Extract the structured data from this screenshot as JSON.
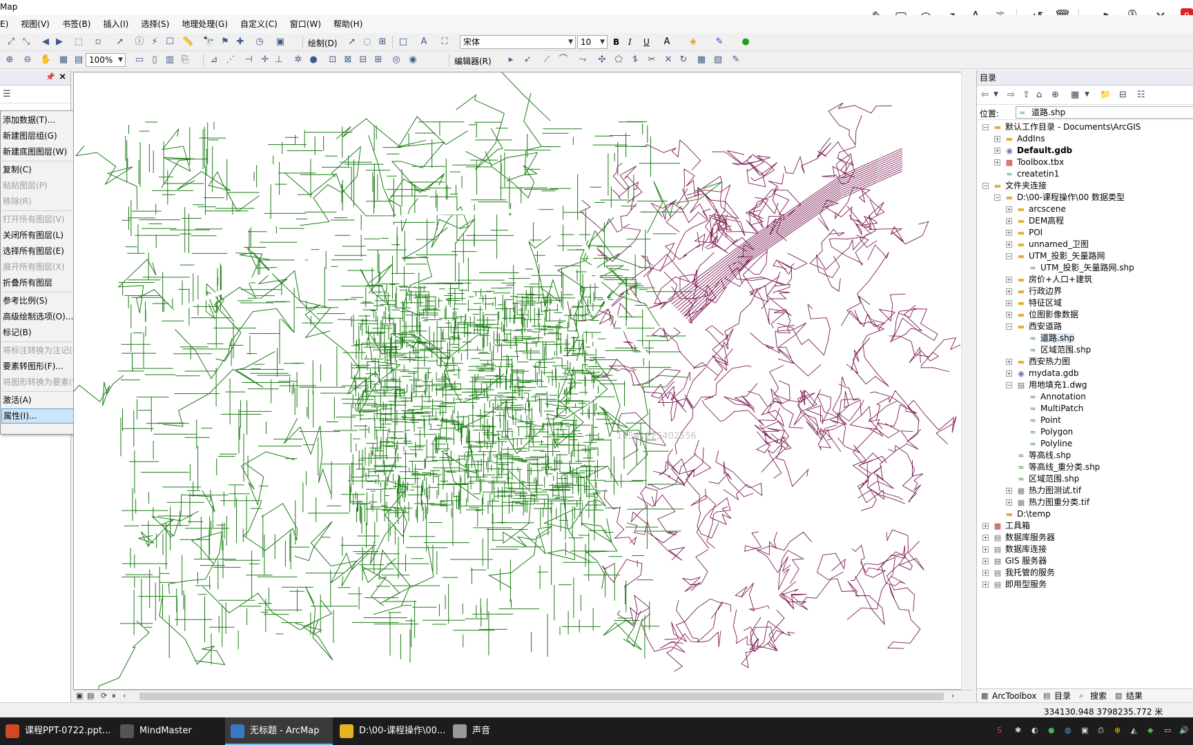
{
  "window": {
    "title": "Map"
  },
  "menu": [
    "E)",
    "视图(V)",
    "书签(B)",
    "插入(I)",
    "选择(S)",
    "地理处理(G)",
    "自定义(C)",
    "窗口(W)",
    "帮助(H)"
  ],
  "toolbar1": {
    "draw_label": "绘制(D)",
    "font_name": "宋体",
    "font_size": "10",
    "bold": "B",
    "italic": "I",
    "underline": "U"
  },
  "toolbar2": {
    "zoom": "100%",
    "editor_label": "编辑器(R)"
  },
  "toc_menu": {
    "items": [
      {
        "label": "添加数据(T)...",
        "enabled": true
      },
      {
        "label": "新建图层组(G)",
        "enabled": true
      },
      {
        "label": "新建底图图层(W)",
        "enabled": true
      },
      {
        "label": "复制(C)",
        "enabled": true
      },
      {
        "label": "粘贴图层(P)",
        "enabled": false
      },
      {
        "label": "移除(R)",
        "enabled": false
      },
      {
        "label": "打开所有图层(V)",
        "enabled": false
      },
      {
        "label": "关闭所有图层(L)",
        "enabled": true
      },
      {
        "label": "选择所有图层(E)",
        "enabled": true
      },
      {
        "label": "展开所有图层(X)",
        "enabled": false
      },
      {
        "label": "折叠所有图层",
        "enabled": true
      },
      {
        "label": "参考比例(S)",
        "enabled": true,
        "submenu": true
      },
      {
        "label": "高级绘制选项(O)...",
        "enabled": true
      },
      {
        "label": "标记(B)",
        "enabled": true,
        "submenu": true
      },
      {
        "label": "将标注转换为注记(N)...",
        "enabled": false
      },
      {
        "label": "要素转图形(F)...",
        "enabled": true
      },
      {
        "label": "将图形转换为要素(V)...",
        "enabled": false
      },
      {
        "label": "激活(A)",
        "enabled": true
      },
      {
        "label": "属性(I)...",
        "enabled": true,
        "selected": true
      }
    ]
  },
  "map": {
    "watermark": "11541225402556",
    "colors": {
      "road_green": "#1a7a12",
      "road_purple": "#7a1a52"
    }
  },
  "catalog": {
    "title": "目录",
    "location_label": "位置:",
    "location_value": "道路.shp",
    "tree": [
      {
        "label": "默认工作目录 - Documents\\ArcGIS",
        "level": 0,
        "exp": "-",
        "icon": "folder"
      },
      {
        "label": "AddIns",
        "level": 1,
        "exp": "+",
        "icon": "folder"
      },
      {
        "label": "Default.gdb",
        "level": 1,
        "exp": "+",
        "icon": "gdb",
        "bold": true
      },
      {
        "label": "Toolbox.tbx",
        "level": 1,
        "exp": "+",
        "icon": "tbx"
      },
      {
        "label": "createtin1",
        "level": 1,
        "exp": "",
        "icon": "shp"
      },
      {
        "label": "文件夹连接",
        "level": 0,
        "exp": "-",
        "icon": "folder"
      },
      {
        "label": "D:\\00-课程操作\\00 数据类型",
        "level": 1,
        "exp": "-",
        "icon": "folder"
      },
      {
        "label": "arcscene",
        "level": 2,
        "exp": "+",
        "icon": "folder"
      },
      {
        "label": "DEM高程",
        "level": 2,
        "exp": "+",
        "icon": "folder"
      },
      {
        "label": "POI",
        "level": 2,
        "exp": "+",
        "icon": "folder"
      },
      {
        "label": "unnamed_卫图",
        "level": 2,
        "exp": "+",
        "icon": "folder"
      },
      {
        "label": "UTM_投影_矢量路网",
        "level": 2,
        "exp": "-",
        "icon": "folder"
      },
      {
        "label": "UTM_投影_矢量路网.shp",
        "level": 3,
        "exp": "",
        "icon": "shp"
      },
      {
        "label": "房价+人口+建筑",
        "level": 2,
        "exp": "+",
        "icon": "folder"
      },
      {
        "label": "行政边界",
        "level": 2,
        "exp": "+",
        "icon": "folder"
      },
      {
        "label": "特征区域",
        "level": 2,
        "exp": "+",
        "icon": "folder"
      },
      {
        "label": "位图影像数据",
        "level": 2,
        "exp": "+",
        "icon": "folder"
      },
      {
        "label": "西安道路",
        "level": 2,
        "exp": "-",
        "icon": "folder"
      },
      {
        "label": "道路.shp",
        "level": 3,
        "exp": "",
        "icon": "shp",
        "highlight": true
      },
      {
        "label": "区域范围.shp",
        "level": 3,
        "exp": "",
        "icon": "shp"
      },
      {
        "label": "西安热力图",
        "level": 2,
        "exp": "+",
        "icon": "folder"
      },
      {
        "label": "mydata.gdb",
        "level": 2,
        "exp": "+",
        "icon": "gdb"
      },
      {
        "label": "用地填充1.dwg",
        "level": 2,
        "exp": "-",
        "icon": "srv"
      },
      {
        "label": "Annotation",
        "level": 3,
        "exp": "",
        "icon": "shp"
      },
      {
        "label": "MultiPatch",
        "level": 3,
        "exp": "",
        "icon": "shp"
      },
      {
        "label": "Point",
        "level": 3,
        "exp": "",
        "icon": "shp"
      },
      {
        "label": "Polygon",
        "level": 3,
        "exp": "",
        "icon": "shp"
      },
      {
        "label": "Polyline",
        "level": 3,
        "exp": "",
        "icon": "shp"
      },
      {
        "label": "等高线.shp",
        "level": 2,
        "exp": "",
        "icon": "shp"
      },
      {
        "label": "等高线_重分类.shp",
        "level": 2,
        "exp": "",
        "icon": "shp"
      },
      {
        "label": "区域范围.shp",
        "level": 2,
        "exp": "",
        "icon": "shp"
      },
      {
        "label": "热力图测试.tif",
        "level": 2,
        "exp": "+",
        "icon": "tif"
      },
      {
        "label": "热力图重分类.tif",
        "level": 2,
        "exp": "+",
        "icon": "tif"
      },
      {
        "label": "D:\\temp",
        "level": 1,
        "exp": "",
        "icon": "folder"
      },
      {
        "label": "工具箱",
        "level": 0,
        "exp": "+",
        "icon": "tbx"
      },
      {
        "label": "数据库服务器",
        "level": 0,
        "exp": "+",
        "icon": "srv"
      },
      {
        "label": "数据库连接",
        "level": 0,
        "exp": "+",
        "icon": "srv"
      },
      {
        "label": "GIS 服务器",
        "level": 0,
        "exp": "+",
        "icon": "srv"
      },
      {
        "label": "我托管的服务",
        "level": 0,
        "exp": "+",
        "icon": "srv"
      },
      {
        "label": "即用型服务",
        "level": 0,
        "exp": "+",
        "icon": "srv"
      }
    ],
    "tabs": [
      "ArcToolbox",
      "目录",
      "搜索",
      "结果"
    ]
  },
  "status": {
    "coords": "334130.948  3798235.772 米"
  },
  "taskbar": [
    {
      "label": "课程PPT-0722.ppt...",
      "color": "#d24726"
    },
    {
      "label": "MindMaster",
      "color": "#555555"
    },
    {
      "label": "无标题 - ArcMap",
      "color": "#3a78c3",
      "active": true
    },
    {
      "label": "D:\\00-课程操作\\00...",
      "color": "#e6b422"
    },
    {
      "label": "声音",
      "color": "#999999"
    }
  ]
}
